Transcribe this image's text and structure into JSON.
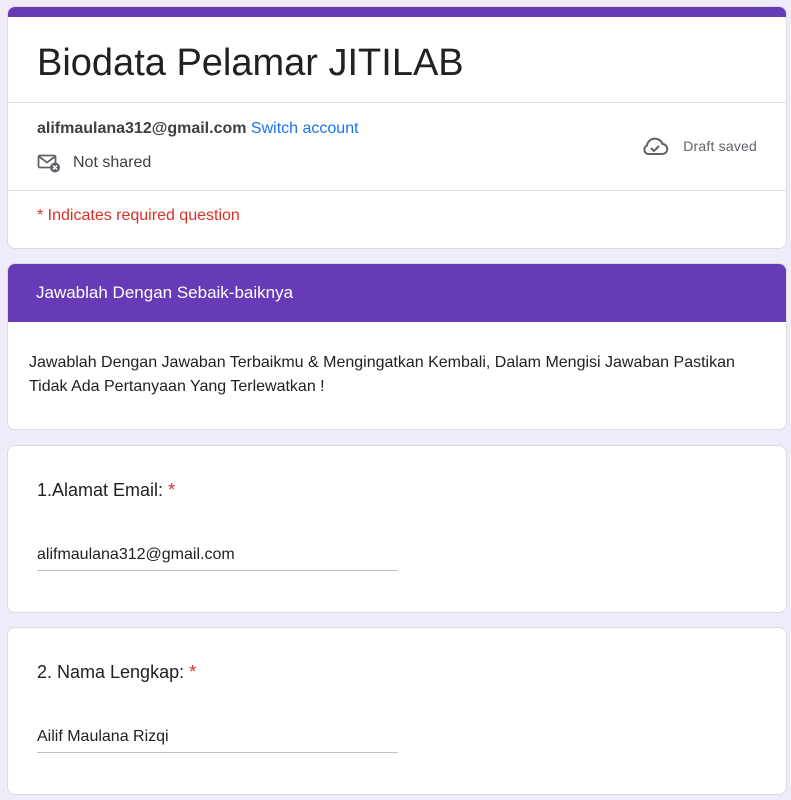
{
  "form": {
    "title": "Biodata Pelamar JITILAB",
    "account_email": "alifmaulana312@gmail.com",
    "switch_account_label": "Switch account",
    "not_shared_label": "Not shared",
    "draft_status": "Draft saved",
    "required_note": "* Indicates required question"
  },
  "section": {
    "title": "Jawablah Dengan Sebaik-baiknya",
    "description": "Jawablah Dengan Jawaban Terbaikmu & Mengingatkan Kembali, Dalam Mengisi Jawaban Pastikan Tidak Ada Pertanyaan Yang Terlewatkan !"
  },
  "questions": [
    {
      "label": "1.Alamat Email:",
      "required_mark": "*",
      "answer": "alifmaulana312@gmail.com"
    },
    {
      "label": "2. Nama Lengkap:",
      "required_mark": "*",
      "answer": "Ailif Maulana Rizqi"
    }
  ],
  "colors": {
    "accent": "#673ab7",
    "background": "#f0ebf8",
    "required": "#d93025",
    "link": "#1a73e8"
  },
  "icons": {
    "not_shared": "mail-off-icon",
    "draft": "cloud-check-icon"
  }
}
